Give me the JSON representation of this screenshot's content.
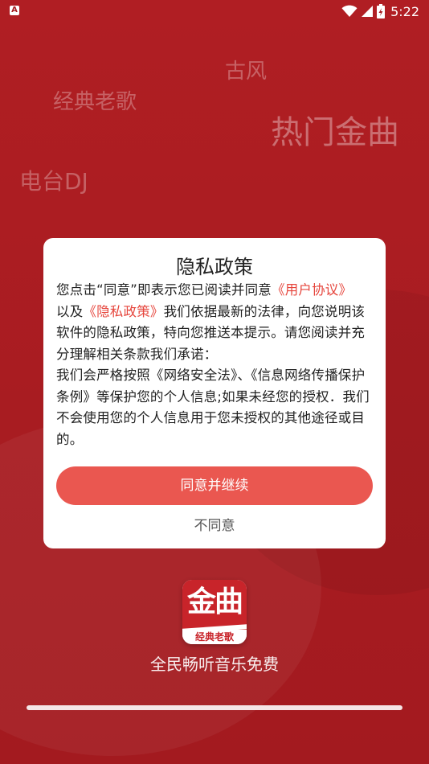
{
  "status_bar": {
    "app_indicator": "A",
    "time": "5:22",
    "icons": [
      "wifi-icon",
      "signal-icon",
      "battery-icon"
    ]
  },
  "background_tags": {
    "gufeng": "古风",
    "jingdian": "经典老歌",
    "remen": "热门金曲",
    "diantai": "电台DJ"
  },
  "dialog": {
    "title": "隐私政策",
    "body_part1": "您点击“同意”即表示您已阅读并同意",
    "user_agreement_link": "《用户协议》",
    "body_part2": "以及",
    "privacy_policy_link": "《隐私政策》",
    "body_part3": "我们依据最新的法律，向您说明该软件的隐私政策，特向您推送本提示。请您阅读并充分理解相关条款我们承诺：",
    "body_part4": "我们会严格按照《网络安全法》、《信息网络传播保护条例》等保护您的个人信息;如果未经您的授权．我们不会使用您的个人信息用于您未授权的其他途径或目的。",
    "agree_label": "同意并继续",
    "disagree_label": "不同意"
  },
  "app": {
    "logo_title": "金曲",
    "logo_subtitle": "经典老歌",
    "slogan": "全民畅听音乐免费"
  },
  "loading": {
    "progress_fraction": 1.0
  },
  "colors": {
    "background": "#a61c20",
    "accent": "#ea5750",
    "link": "#e6453c"
  }
}
